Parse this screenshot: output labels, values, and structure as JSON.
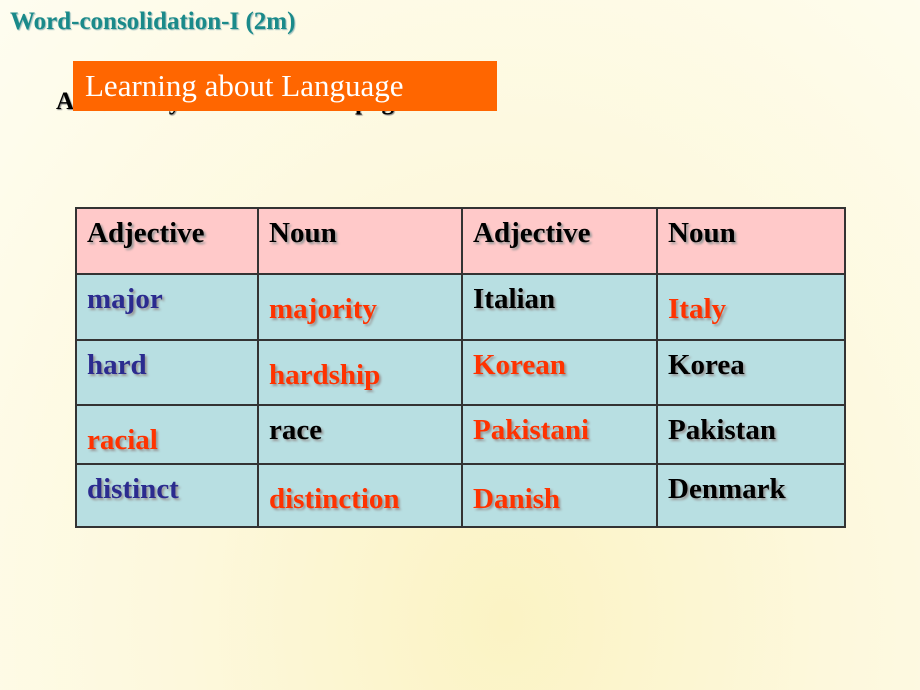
{
  "slide": {
    "title": "Word-consolidation-I (2m)",
    "section_badge": "Learning about Language",
    "subtitle": "Answer keys for excise 1 on page 4:"
  },
  "table": {
    "headers": [
      "Adjective",
      "Noun",
      "Adjective",
      "Noun"
    ],
    "rows": [
      [
        "major",
        "majority",
        "Italian",
        "Italy"
      ],
      [
        "hard",
        "hardship",
        "Korean",
        "Korea"
      ],
      [
        "racial",
        "race",
        "Pakistani",
        "Pakistan"
      ],
      [
        "distinct",
        "distinction",
        "Danish",
        "Denmark"
      ]
    ]
  },
  "colors": {
    "title": "#1a8a8a",
    "badge_bg": "#ff6600",
    "header_bg": "#ffc9c9",
    "body_bg": "#b8dfe2",
    "given_adjective": "#2b2b8f",
    "answer": "#ff3300",
    "given": "#000000"
  }
}
